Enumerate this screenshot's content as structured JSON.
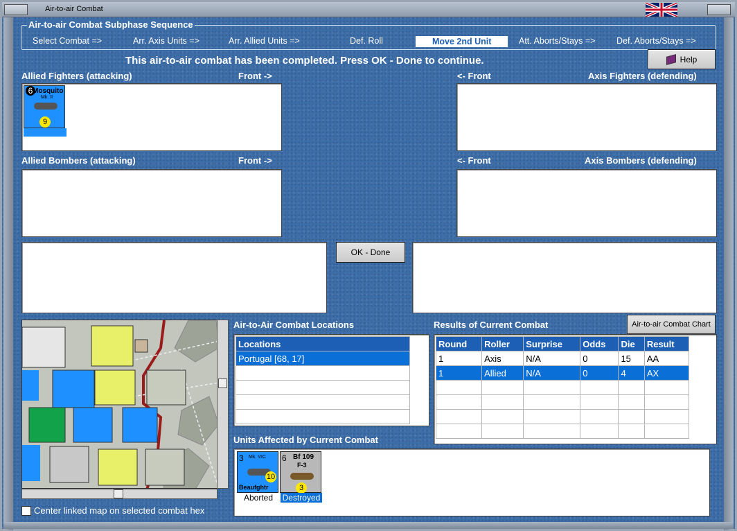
{
  "window": {
    "title": "Air-to-air Combat"
  },
  "sequence": {
    "title": "Air-to-air Combat Subphase Sequence",
    "steps": [
      "Select Combat =>",
      "Arr. Axis Units =>",
      "Arr. Allied Units =>",
      "Def. Roll",
      "Move 2nd Unit",
      "Att. Aborts/Stays =>",
      "Def. Aborts/Stays =>"
    ],
    "active_index": 4
  },
  "message": "This air-to-air combat has been completed.  Press OK - Done to continue.",
  "help_label": "Help",
  "panels": {
    "allied_fighters": "Allied Fighters (attacking)",
    "axis_fighters": "Axis Fighters (defending)",
    "allied_bombers": "Allied Bombers (attacking)",
    "axis_bombers": "Axis Bombers (defending)",
    "front_right": "Front ->",
    "front_left": "<- Front"
  },
  "allied_fighter_counter": {
    "name": "Mosquito",
    "model": "Mk. II",
    "value_top": "6",
    "value_bottom": "9"
  },
  "ok_label": "OK - Done",
  "locations": {
    "title": "Air-to-Air Combat Locations",
    "header": "Locations",
    "rows": [
      "Portugal [68, 17]"
    ]
  },
  "results": {
    "title": "Results of Current Combat",
    "chart_button": "Air-to-air Combat Chart",
    "columns": [
      "Round",
      "Roller",
      "Surprise",
      "Odds",
      "Die",
      "Result"
    ],
    "rows": [
      [
        "1",
        "Axis",
        "N/A",
        "0",
        "15",
        "AA"
      ],
      [
        "1",
        "Allied",
        "N/A",
        "0",
        "4",
        "AX"
      ]
    ]
  },
  "affected": {
    "title": "Units Affected by Current Combat",
    "units": [
      {
        "name": "Beaufghtr",
        "model": "Mk. VIC",
        "top": "3",
        "bottom": "10",
        "status": "Aborted",
        "color": "#1e90ff"
      },
      {
        "name": "Bf 109",
        "model": "F-3",
        "top": "6",
        "bottom": "3",
        "status": "Destroyed",
        "color": "#b8b8b8"
      }
    ]
  },
  "map": {
    "center_checkbox": "Center linked map on selected combat hex"
  }
}
